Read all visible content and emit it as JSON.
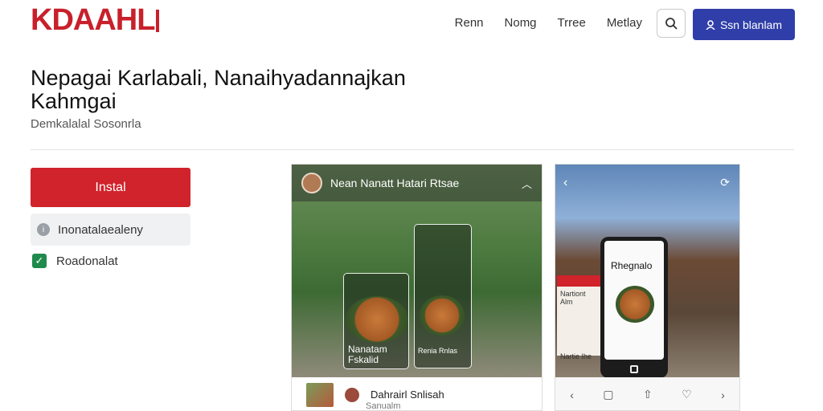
{
  "brand": {
    "logo_text": "KDAAHL"
  },
  "nav": {
    "items": [
      "Renn",
      "Nomg",
      "Trree",
      "Metlay"
    ]
  },
  "header": {
    "cta_label": "Ssn blanlam"
  },
  "main": {
    "title": "Nepagai Karlabali, Nanaihyadannajkan Kahmgai",
    "subtitle": "Demkalalal Sosonrla",
    "install_label": "Instal",
    "info_label": "Inonatalaealeny",
    "check_label": "Roadonalat"
  },
  "card1": {
    "header_title": "Nean Nanatt Hatari Rtsae",
    "food_card_label": "Nanatam Fskalid",
    "food_card_label2": "Renia Rnlas",
    "footer_title": "Dahrairl Snlisah",
    "footer_sub": "Sanualm"
  },
  "card2": {
    "phone_title": "Rhegnalo",
    "side_label": "Nartiont Alm",
    "side_label2": "Nartie Ihe"
  },
  "colors": {
    "brand_red": "#c8202b",
    "install_red": "#d0232b",
    "cta_blue": "#2f3ea8",
    "check_green": "#1e8a4c"
  },
  "icons": [
    "search-icon",
    "user-icon",
    "info-icon",
    "check-icon",
    "chevron-up-icon",
    "back-icon",
    "share-icon",
    "heart-icon",
    "forward-icon",
    "tab-icon"
  ]
}
